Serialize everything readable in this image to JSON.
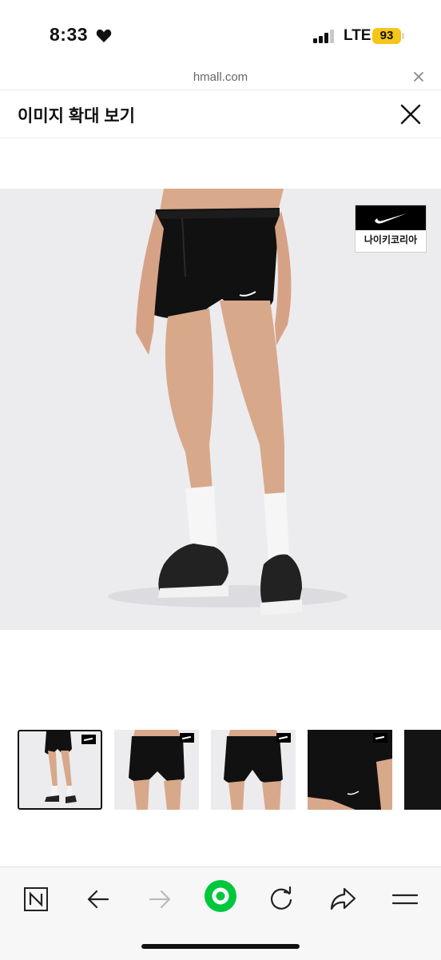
{
  "status_bar": {
    "time": "8:33",
    "network": "LTE",
    "battery": "93"
  },
  "browser": {
    "url": "hmall.com"
  },
  "header": {
    "title": "이미지 확대 보기"
  },
  "product": {
    "brand_badge": "나이키코리아",
    "thumbnail_count": 5,
    "selected_thumbnail": 1
  },
  "icons": {
    "status": [
      "heart-icon",
      "signal-icon",
      "battery-icon"
    ],
    "header": [
      "close-icon"
    ],
    "toolbar": [
      "naver-n-icon",
      "back-arrow-icon",
      "forward-arrow-icon",
      "green-home-icon",
      "refresh-icon",
      "share-icon",
      "menu-icon"
    ]
  },
  "colors": {
    "accent_green": "#00c73c",
    "battery_yellow": "#f5c518",
    "image_bg": "#ececee"
  }
}
